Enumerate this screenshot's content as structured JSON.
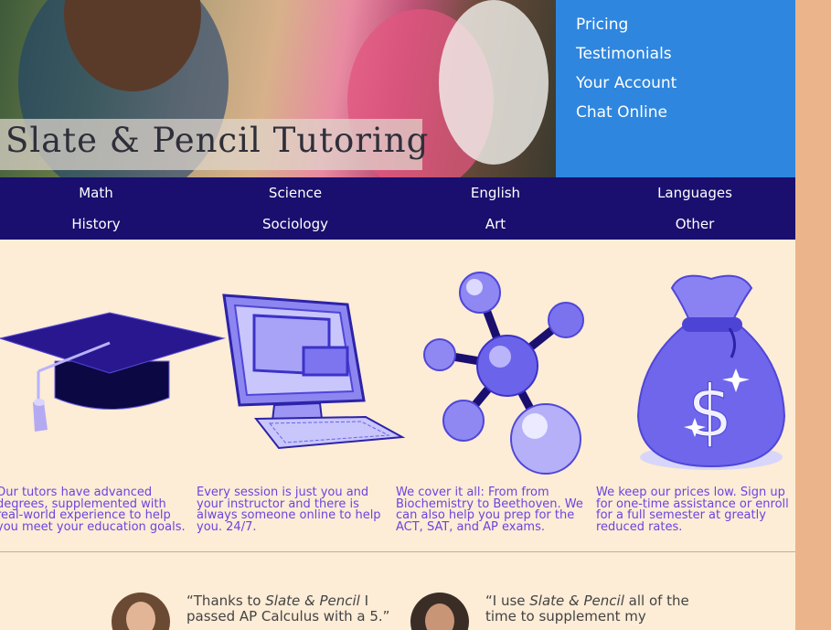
{
  "hero": {
    "title": "Slate & Pencil Tutoring"
  },
  "top_menu": {
    "items": [
      "Pricing",
      "Testimonials",
      "Your Account",
      "Chat Online"
    ]
  },
  "categories": [
    "Math",
    "Science",
    "English",
    "Languages",
    "History",
    "Sociology",
    "Art",
    "Other"
  ],
  "features": [
    {
      "icon": "graduation-cap-icon",
      "text": "Our tutors have advanced degrees, supplemented with real-world experience to help you meet your education goals."
    },
    {
      "icon": "computer-icon",
      "text": "Every session is just you and your instructor and there is always someone online to help you. 24/7."
    },
    {
      "icon": "molecule-icon",
      "text": "We cover it all: From from Biochemistry to Beethoven. We can also help you prep for the ACT, SAT, and AP exams."
    },
    {
      "icon": "money-bag-icon",
      "text": "We keep our prices low. Sign up for one-time assistance or enroll for a full semester at greatly reduced rates."
    }
  ],
  "testimonials": [
    {
      "before": "“Thanks to ",
      "brand": "Slate & Pencil",
      "after": " I passed AP Calculus with a 5.”"
    },
    {
      "before": "“I use ",
      "brand": "Slate & Pencil",
      "after": " all of the time to supplement my"
    }
  ],
  "colors": {
    "page_bg": "#ecb48a",
    "content_bg": "#fdecd6",
    "top_menu_bg": "#2e86de",
    "category_nav_bg": "#1a0f6e",
    "feature_text": "#6a44e0"
  }
}
